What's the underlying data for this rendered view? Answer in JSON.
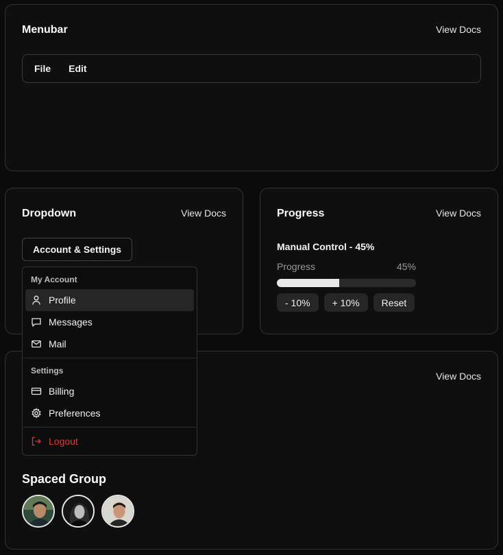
{
  "menubar_card": {
    "title": "Menubar",
    "view_docs": "View Docs",
    "menu": [
      "File",
      "Edit"
    ]
  },
  "dropdown_card": {
    "title": "Dropdown",
    "view_docs": "View Docs",
    "trigger_label": "Account & Settings",
    "menu": {
      "account_label": "My Account",
      "account_items": [
        {
          "label": "Profile",
          "icon": "user-icon",
          "active": true
        },
        {
          "label": "Messages",
          "icon": "message-icon"
        },
        {
          "label": "Mail",
          "icon": "mail-icon"
        }
      ],
      "settings_label": "Settings",
      "settings_items": [
        {
          "label": "Billing",
          "icon": "credit-card-icon"
        },
        {
          "label": "Preferences",
          "icon": "gear-icon"
        }
      ],
      "logout_label": "Logout",
      "logout_color": "#d83a3a"
    }
  },
  "progress_card": {
    "title": "Progress",
    "view_docs": "View Docs",
    "heading": "Manual Control - 45%",
    "label": "Progress",
    "value_text": "45%",
    "value": 0.45,
    "buttons": [
      "- 10%",
      "+ 10%",
      "Reset"
    ]
  },
  "avatar_card": {
    "view_docs": "View Docs",
    "group_title": "Spaced Group",
    "avatars": [
      {
        "name": "avatar-1"
      },
      {
        "name": "avatar-2"
      },
      {
        "name": "avatar-3"
      }
    ]
  }
}
